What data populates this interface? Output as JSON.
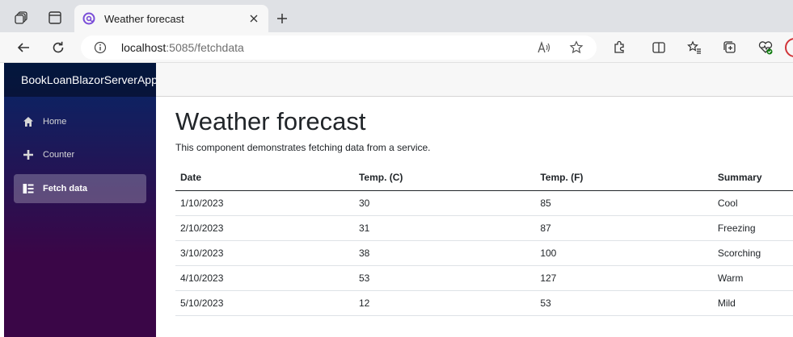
{
  "browser": {
    "tab": {
      "title": "Weather forecast"
    },
    "address": {
      "host": "localhost",
      "path": ":5085/fetchdata"
    }
  },
  "app": {
    "brand": "BookLoanBlazorServerApp",
    "nav": [
      {
        "label": "Home",
        "icon": "home-icon"
      },
      {
        "label": "Counter",
        "icon": "plus-icon"
      },
      {
        "label": "Fetch data",
        "icon": "list-icon",
        "active": true
      }
    ]
  },
  "page": {
    "title": "Weather forecast",
    "description": "This component demonstrates fetching data from a service.",
    "table": {
      "headers": [
        "Date",
        "Temp. (C)",
        "Temp. (F)",
        "Summary"
      ],
      "rows": [
        [
          "1/10/2023",
          "30",
          "85",
          "Cool"
        ],
        [
          "2/10/2023",
          "31",
          "87",
          "Freezing"
        ],
        [
          "3/10/2023",
          "38",
          "100",
          "Scorching"
        ],
        [
          "4/10/2023",
          "53",
          "127",
          "Warm"
        ],
        [
          "5/10/2023",
          "12",
          "53",
          "Mild"
        ]
      ]
    }
  },
  "colors": {
    "sidebar_top": "#052767",
    "sidebar_bottom": "#3a0647",
    "accent_profile": "#d13438"
  }
}
